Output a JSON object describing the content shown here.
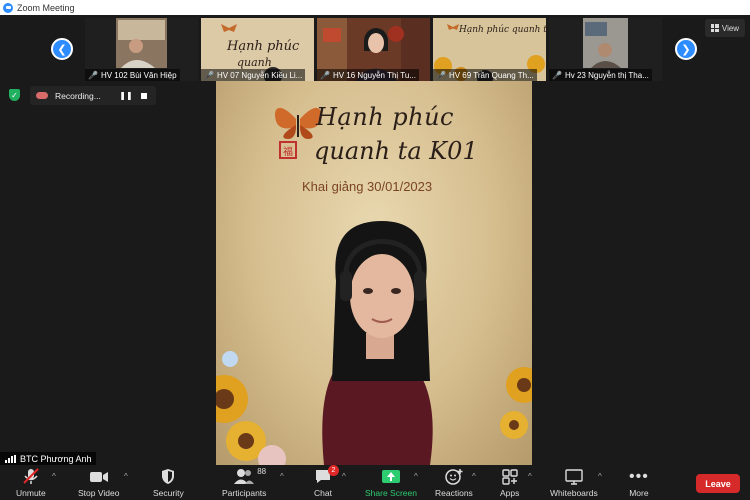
{
  "window": {
    "title": "Zoom Meeting"
  },
  "strip": {
    "view_label": "View",
    "participants": [
      {
        "name": "HV 102 Bùi Văn Hiệp"
      },
      {
        "name": "HV 07 Nguyễn Kiều Li..."
      },
      {
        "name": "HV 16 Nguyễn Thị Tu..."
      },
      {
        "name": "HV 69 Trần Quang Th..."
      },
      {
        "name": "Hv 23 Nguyễn thị Tha..."
      }
    ]
  },
  "recording": {
    "label": "Recording..."
  },
  "main_video": {
    "headline_line1": "Hạnh phúc",
    "headline_line2": "quanh ta K01",
    "opening_date": "Khai giảng 30/01/2023"
  },
  "self_view": {
    "name": "BTC Phương Anh"
  },
  "toolbar": {
    "unmute": "Unmute",
    "stop_video": "Stop Video",
    "security": "Security",
    "participants": "Participants",
    "participants_count": "88",
    "chat": "Chat",
    "chat_badge": "2",
    "share_screen": "Share Screen",
    "reactions": "Reactions",
    "apps": "Apps",
    "whiteboards": "Whiteboards",
    "more": "More",
    "leave": "Leave"
  },
  "colors": {
    "accent": "#2d8cff",
    "leave": "#d62a2a",
    "share": "#2ecc71",
    "muted": "#e02828"
  }
}
